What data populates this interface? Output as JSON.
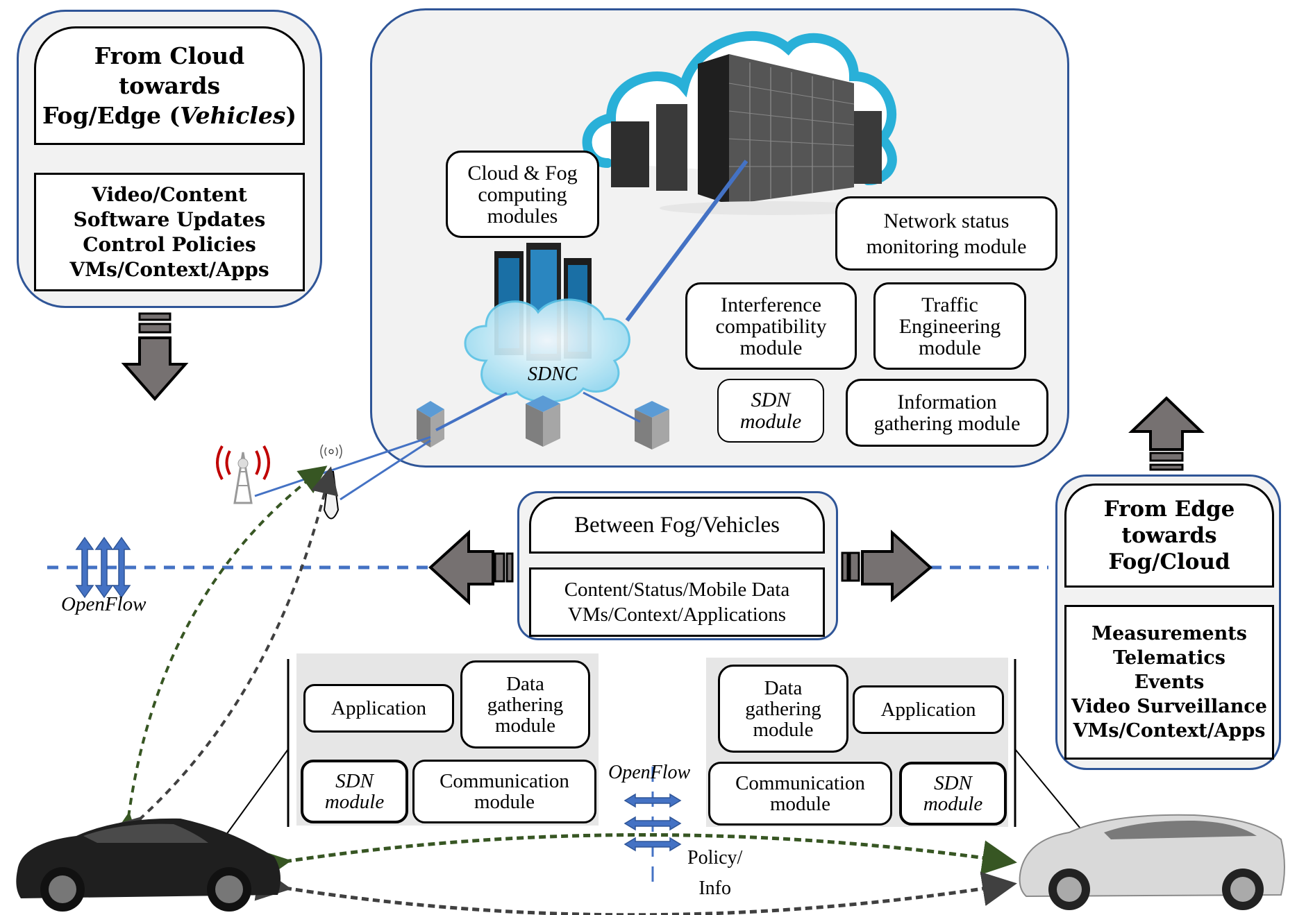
{
  "left_panel": {
    "title_line1": "From Cloud",
    "title_line2": "towards",
    "title_line3_prefix": "Fog/Edge (",
    "title_line3_italic": "Vehicles",
    "title_line3_suffix": ")",
    "items": "Video/Content\nSoftware Updates\nControl Policies\nVMs/Context/Apps"
  },
  "cloud_panel": {
    "cloud_fog_modules": "Cloud & Fog\ncomputing\nmodules",
    "network_status": "Network status\nmonitoring module",
    "interference": "Interference\ncompatibility\nmodule",
    "traffic_engineering": "Traffic\nEngineering\nmodule",
    "sdn_module": "SDN\nmodule",
    "information_gathering": "Information\ngathering module",
    "sdnc_label": "SDNC"
  },
  "middle_panel": {
    "title": "Between Fog/Vehicles",
    "items": "Content/Status/Mobile Data\nVMs/Context/Applications"
  },
  "right_panel": {
    "title": "From Edge\ntowards\nFog/Cloud",
    "items": "Measurements\nTelematics\nEvents\nVideo Surveillance\nVMs/Context/Apps"
  },
  "openflow_left": "OpenFlow",
  "openflow_center": "OpenFlow",
  "policy_info": "Policy/\nInfo",
  "vehicle_left_stack": {
    "application": "Application",
    "data_gathering": "Data\ngathering\nmodule",
    "sdn_module": "SDN\nmodule",
    "communication": "Communication\nmodule"
  },
  "vehicle_right_stack": {
    "data_gathering": "Data\ngathering\nmodule",
    "application": "Application",
    "communication": "Communication\nmodule",
    "sdn_module": "SDN\nmodule"
  },
  "colors": {
    "panel_border": "#2f5597",
    "panel_fill": "#f2f2f2",
    "link_blue": "#4472c4",
    "arrow_gray": "#767171",
    "green_dash": "#375623",
    "dark_dash": "#404040",
    "tower_red": "#c00000"
  }
}
